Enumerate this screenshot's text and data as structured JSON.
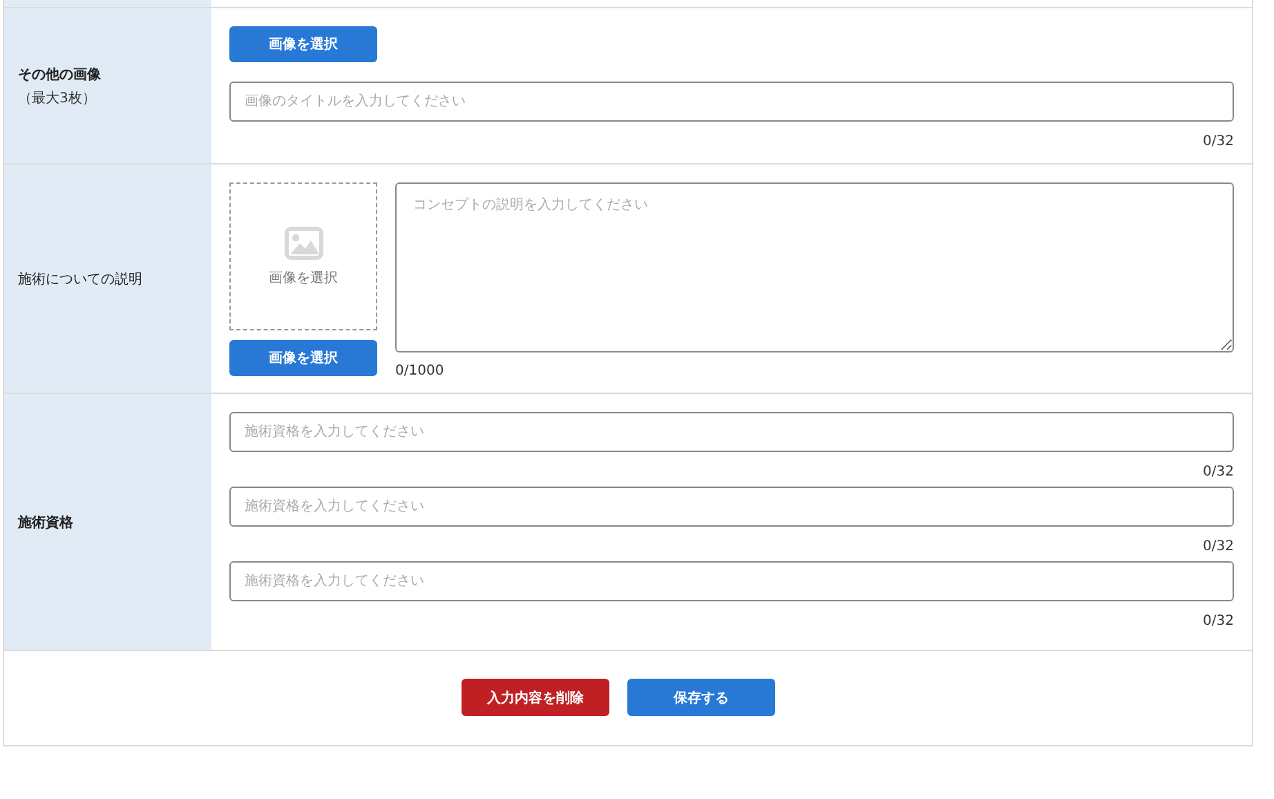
{
  "rows": [
    {
      "kind": "image_title",
      "label": "その他の画像",
      "sublabel": "（最大3枚）",
      "bold": true,
      "button": "画像を選択",
      "placeholder": "画像のタイトルを入力してください",
      "counter": "0/32"
    },
    {
      "kind": "image_description",
      "label": "施術についての説明",
      "bold": false,
      "dropzone_text": "画像を選択",
      "button": "画像を選択",
      "placeholder": "コンセプトの説明を入力してください",
      "counter": "0/1000"
    },
    {
      "kind": "text_list",
      "label": "施術資格",
      "bold": true,
      "fields": [
        {
          "placeholder": "施術資格を入力してください",
          "counter": "0/32"
        },
        {
          "placeholder": "施術資格を入力してください",
          "counter": "0/32"
        },
        {
          "placeholder": "施術資格を入力してください",
          "counter": "0/32"
        }
      ]
    }
  ],
  "buttons": [
    {
      "label": "入力内容を削除",
      "kind": "danger"
    },
    {
      "label": "保存する",
      "kind": "primary"
    }
  ]
}
